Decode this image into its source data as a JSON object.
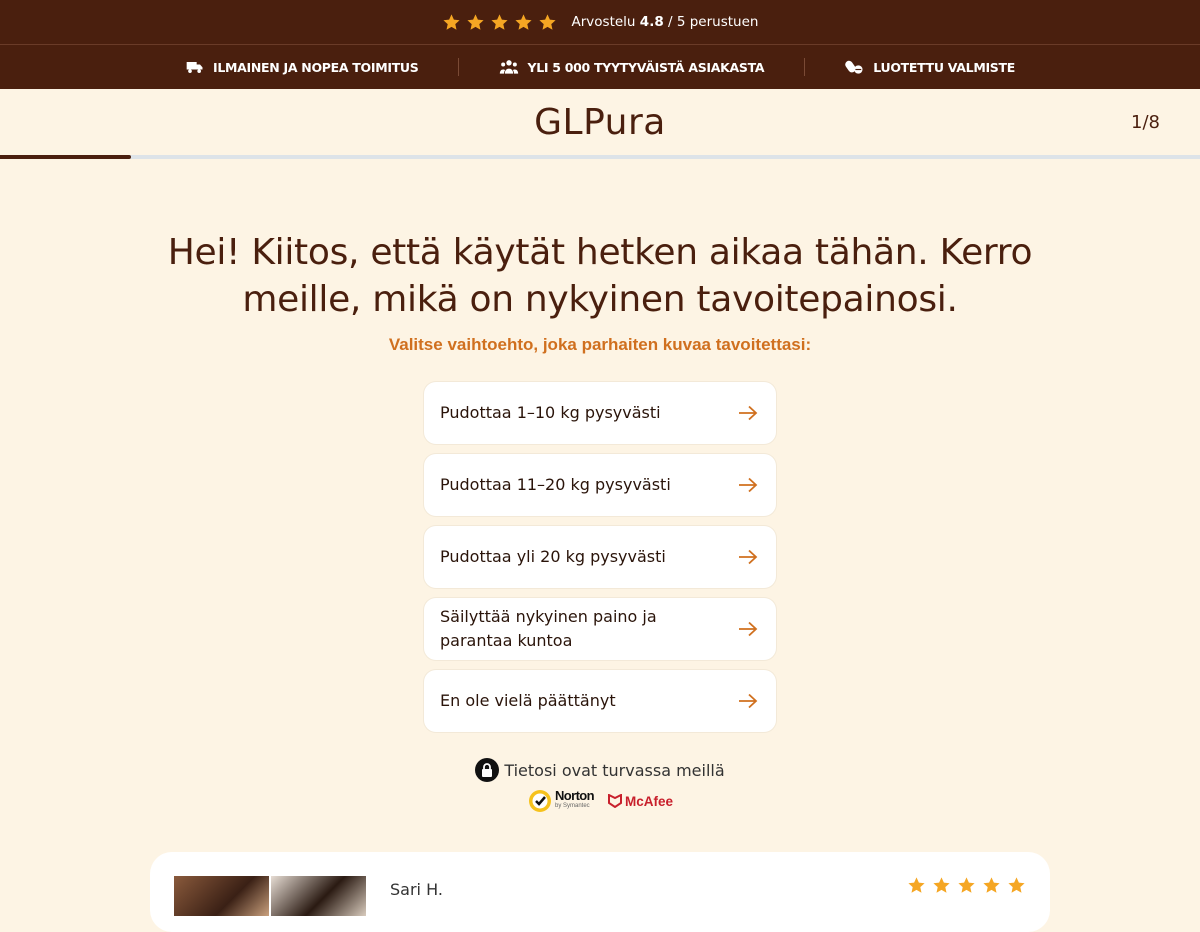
{
  "top_bar": {
    "rating_prefix": "Arvostelu",
    "rating_value": "4.8",
    "rating_suffix": "/ 5 perustuen",
    "stars": 5,
    "star_color": "#f5a623"
  },
  "features": [
    {
      "icon": "truck-icon",
      "label": "ILMAINEN JA NOPEA TOIMITUS"
    },
    {
      "icon": "people-icon",
      "label": "YLI 5 000 TYYTYVÄISTÄ ASIAKASTA"
    },
    {
      "icon": "pills-icon",
      "label": "LUOTETTU VALMISTE"
    }
  ],
  "header": {
    "logo": "GLPura",
    "step": "1/8",
    "progress": 0.109
  },
  "question": {
    "title": "Hei! Kiitos, että käytät hetken aikaa tähän. Kerro meille, mikä on nykyinen tavoitepainosi.",
    "subtitle": "Valitse vaihtoehto, joka parhaiten kuvaa tavoitettasi:"
  },
  "options": [
    {
      "label": "Pudottaa 1–10 kg pysyvästi"
    },
    {
      "label": "Pudottaa 11–20 kg pysyvästi"
    },
    {
      "label": "Pudottaa yli 20 kg pysyvästi"
    },
    {
      "label": "Säilyttää nykyinen paino ja parantaa kuntoa"
    },
    {
      "label": "En ole vielä päättänyt"
    }
  ],
  "security": {
    "text": "Tietosi ovat turvassa meillä",
    "norton_name": "Norton",
    "norton_sub": "by Symantec",
    "mcafee": "McAfee"
  },
  "review": {
    "name": "Sari H.",
    "stars": 5
  },
  "colors": {
    "brand_dark": "#4a1f0e",
    "accent_orange": "#d0701f",
    "background": "#fdf4e4",
    "star": "#f5a623"
  }
}
